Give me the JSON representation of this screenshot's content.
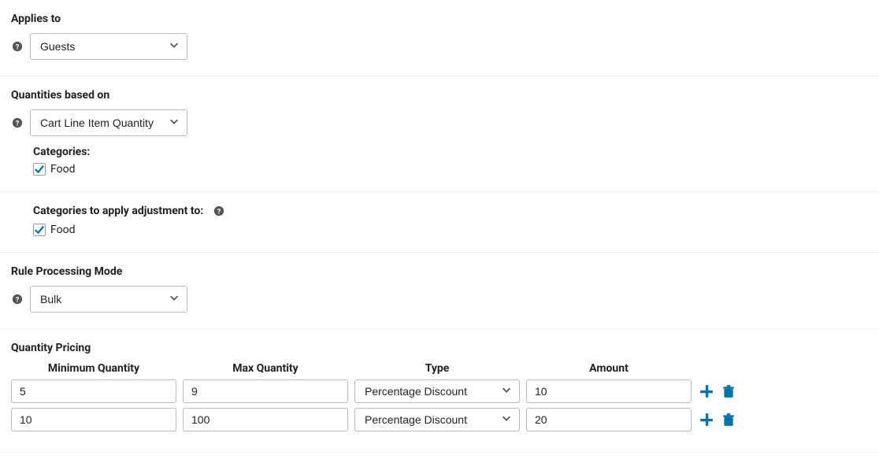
{
  "applies_to": {
    "label": "Applies to",
    "value": "Guests"
  },
  "quantities_based_on": {
    "label": "Quantities based on",
    "value": "Cart Line Item Quantity",
    "categories_label": "Categories:",
    "categories": [
      {
        "label": "Food",
        "checked": true
      }
    ]
  },
  "categories_apply_adjustment": {
    "label": "Categories to apply adjustment to:",
    "items": [
      {
        "label": "Food",
        "checked": true
      }
    ]
  },
  "rule_processing_mode": {
    "label": "Rule Processing Mode",
    "value": "Bulk"
  },
  "quantity_pricing": {
    "label": "Quantity Pricing",
    "headers": {
      "min": "Minimum Quantity",
      "max": "Max Quantity",
      "type": "Type",
      "amount": "Amount"
    },
    "rows": [
      {
        "min": "5",
        "max": "9",
        "type": "Percentage Discount",
        "amount": "10"
      },
      {
        "min": "10",
        "max": "100",
        "type": "Percentage Discount",
        "amount": "20"
      }
    ]
  },
  "colors": {
    "accent": "#0073aa"
  }
}
